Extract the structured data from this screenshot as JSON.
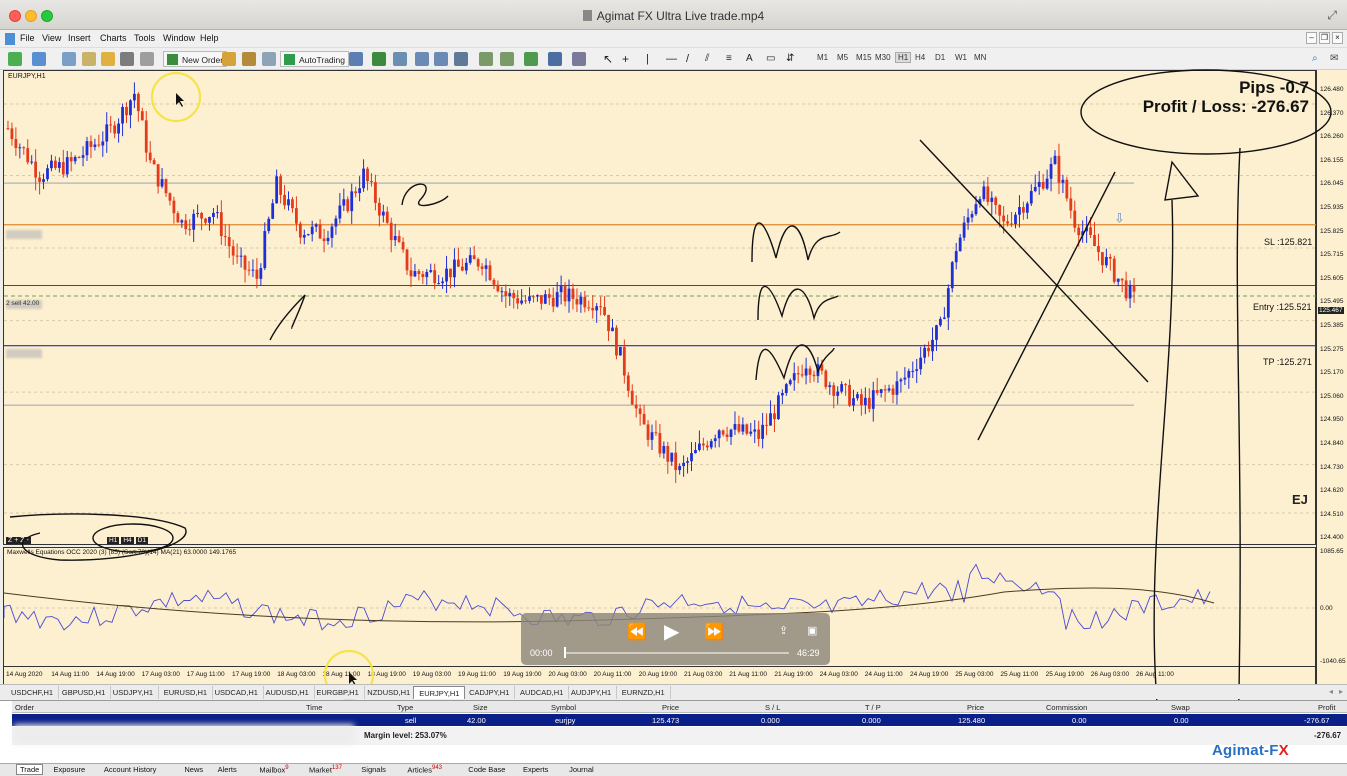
{
  "window": {
    "title": "Agimat FX Ultra Live trade.mp4"
  },
  "menu": [
    "File",
    "View",
    "Insert",
    "Charts",
    "Tools",
    "Window",
    "Help"
  ],
  "toolbar": {
    "new_order": "New Order",
    "autotrading": "AutoTrading",
    "periods": [
      "M1",
      "M5",
      "M15",
      "M30",
      "H1",
      "H4",
      "D1",
      "W1",
      "MN"
    ],
    "active_period": "H1"
  },
  "chart": {
    "symbol": "EURJPY,H1",
    "y_ticks": [
      "126.480",
      "126.370",
      "126.260",
      "126.155",
      "126.045",
      "125.935",
      "125.825",
      "125.715",
      "125.605",
      "125.495",
      "125.385",
      "125.275",
      "125.170",
      "125.060",
      "124.950",
      "124.840",
      "124.730",
      "124.620",
      "124.510",
      "124.400"
    ],
    "x_ticks": [
      "14 Aug 2020",
      "14 Aug 11:00",
      "14 Aug 19:00",
      "17 Aug 03:00",
      "17 Aug 11:00",
      "17 Aug 19:00",
      "18 Aug 03:00",
      "18 Aug 11:00",
      "18 Aug 19:00",
      "19 Aug 03:00",
      "19 Aug 11:00",
      "19 Aug 19:00",
      "20 Aug 03:00",
      "20 Aug 11:00",
      "20 Aug 19:00",
      "21 Aug 03:00",
      "21 Aug 11:00",
      "21 Aug 19:00",
      "24 Aug 03:00",
      "24 Aug 11:00",
      "24 Aug 19:00",
      "25 Aug 03:00",
      "25 Aug 11:00",
      "25 Aug 19:00",
      "26 Aug 03:00",
      "26 Aug 11:00"
    ],
    "current_price": "125.467",
    "sl_label": "SL :125.821",
    "entry_label": "Entry :125.521",
    "tp_label": "TP :125.271",
    "order_tag": "2 sell 42.00",
    "pips": "Pips -0.7",
    "profit_loss": "Profit / Loss: -276.67",
    "pair_tag": "EJ",
    "zoom": "Z + Z -",
    "timeframes": [
      "H1",
      "H4",
      "D1"
    ],
    "colors": {
      "bull": "#1f2fd6",
      "bear": "#e33b1c",
      "background": "#fdf0d0",
      "sl": "#e08830",
      "tp": "#2a2ab0"
    }
  },
  "indicator": {
    "label": "Maxwells Equations OCC 2020 (3) (85) (Sort:70)(14) MA(21) 63.0000 149.1765",
    "y_ticks": [
      "1085.65",
      "0.00",
      "-1040.65"
    ]
  },
  "player": {
    "current_time": "00:00",
    "duration": "46:29",
    "progress": 0
  },
  "symbol_tabs": [
    "USDCHF,H1",
    "GBPUSD,H1",
    "USDJPY,H1",
    "EURUSD,H1",
    "USDCAD,H1",
    "AUDUSD,H1",
    "EURGBP,H1",
    "NZDUSD,H1",
    "EURJPY,H1",
    "CADJPY,H1",
    "AUDCAD,H1",
    "AUDJPY,H1",
    "EURNZD,H1"
  ],
  "active_symbol_tab": "EURJPY,H1",
  "terminal": {
    "headers": [
      "Order",
      "Time",
      "Type",
      "Size",
      "Symbol",
      "Price",
      "S / L",
      "T / P",
      "Price",
      "Commission",
      "Swap",
      "Profit"
    ],
    "row": {
      "type": "sell",
      "size": "42.00",
      "symbol": "eurjpy",
      "open_price": "125.473",
      "sl": "0.000",
      "tp": "0.000",
      "price": "125.480",
      "commission": "0.00",
      "swap": "0.00",
      "profit": "-276.67"
    },
    "margin_level": "Margin level: 253.07%",
    "total_profit": "-276.67"
  },
  "bottom_tabs": [
    {
      "label": "Trade"
    },
    {
      "label": "Exposure"
    },
    {
      "label": "Account History"
    },
    {
      "label": "News"
    },
    {
      "label": "Alerts"
    },
    {
      "label": "Mailbox",
      "badge": "9"
    },
    {
      "label": "Market",
      "badge": "137"
    },
    {
      "label": "Signals"
    },
    {
      "label": "Articles",
      "badge": "943"
    },
    {
      "label": "Code Base"
    },
    {
      "label": "Experts"
    },
    {
      "label": "Journal"
    }
  ],
  "brand": {
    "a": "Agimat-F",
    "b": "X"
  }
}
